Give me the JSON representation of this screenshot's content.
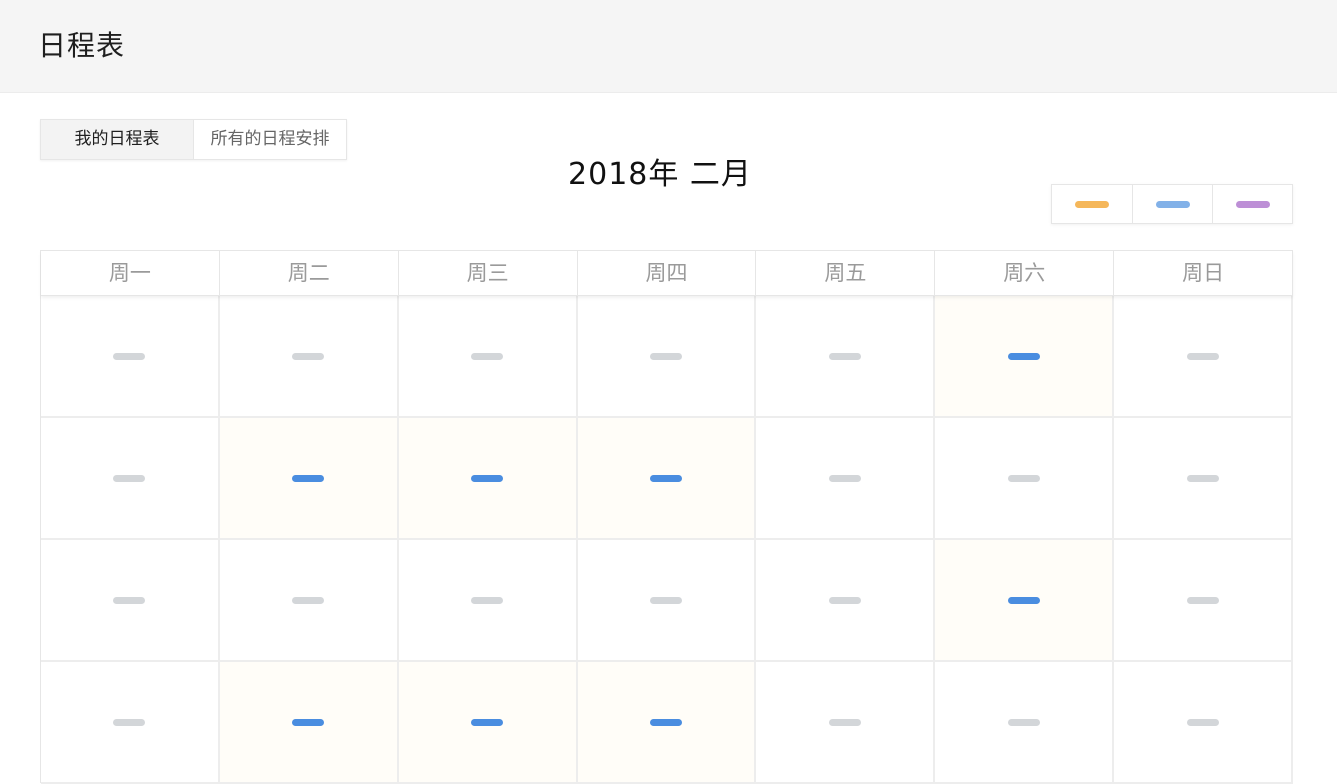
{
  "header": {
    "title": "日程表"
  },
  "tabs": [
    {
      "label": "我的日程表",
      "active": true
    },
    {
      "label": "所有的日程安排",
      "active": false
    }
  ],
  "calendar": {
    "month_label": "2018年 二月",
    "weekdays": [
      "周一",
      "周二",
      "周三",
      "周四",
      "周五",
      "周六",
      "周日"
    ],
    "weeks": [
      [
        false,
        false,
        false,
        false,
        false,
        true,
        false
      ],
      [
        false,
        true,
        true,
        true,
        false,
        false,
        false
      ],
      [
        false,
        false,
        false,
        false,
        false,
        true,
        false
      ],
      [
        false,
        true,
        true,
        true,
        false,
        false,
        false
      ]
    ],
    "colors": {
      "scheduled_bar": "#4a8de0",
      "empty_bar": "#d3d6d9",
      "scheduled_bg": "#fffdf8"
    }
  },
  "legend": [
    {
      "color": "#f5b75a"
    },
    {
      "color": "#82b1e8"
    },
    {
      "color": "#bd8fd6"
    }
  ]
}
